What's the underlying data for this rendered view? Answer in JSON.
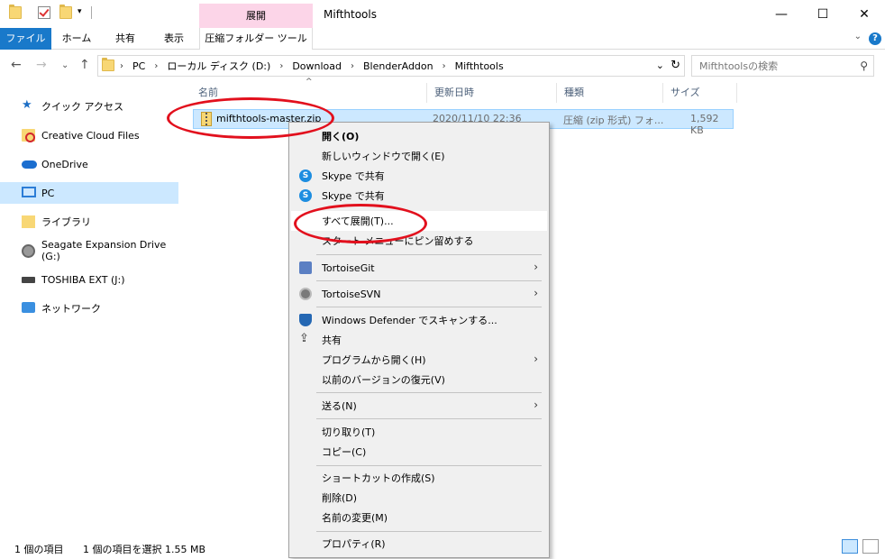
{
  "window": {
    "title": "Mifthtools",
    "contextual_tab_header": "展開",
    "controls": {
      "minimize": "—",
      "maximize": "☐",
      "close": "✕"
    }
  },
  "ribbon": {
    "tabs": [
      "ファイル",
      "ホーム",
      "共有",
      "表示",
      "圧縮フォルダー ツール"
    ],
    "help": "?"
  },
  "address": {
    "crumbs": [
      "PC",
      "ローカル ディスク (D:)",
      "Download",
      "BlenderAddon",
      "Mifthtools"
    ],
    "search_placeholder": "Mifthtoolsの検索"
  },
  "sidebar": {
    "items": [
      {
        "label": "クイック アクセス",
        "icon": "star-icon"
      },
      {
        "label": "Creative Cloud Files",
        "icon": "creative-cloud-icon"
      },
      {
        "label": "OneDrive",
        "icon": "cloud-icon"
      },
      {
        "label": "PC",
        "icon": "computer-icon",
        "selected": true
      },
      {
        "label": "ライブラリ",
        "icon": "library-icon"
      },
      {
        "label": "Seagate Expansion Drive (G:)",
        "icon": "drive-icon"
      },
      {
        "label": "TOSHIBA EXT (J:)",
        "icon": "usb-drive-icon"
      },
      {
        "label": "ネットワーク",
        "icon": "network-icon"
      }
    ]
  },
  "columns": [
    "名前",
    "更新日時",
    "種類",
    "サイズ"
  ],
  "files": [
    {
      "name": "mifthtools-master.zip",
      "modified": "2020/11/10 22:36",
      "type": "圧縮 (zip 形式) フォ...",
      "size": "1,592 KB"
    }
  ],
  "context_menu": {
    "items": [
      "開く(O)",
      "新しいウィンドウで開く(E)",
      "Skype で共有",
      "Skype で共有",
      "すべて展開(T)...",
      "スタート メニューにピン留めする",
      "TortoiseGit",
      "TortoiseSVN",
      "Windows Defender でスキャンする...",
      "共有",
      "プログラムから開く(H)",
      "以前のバージョンの復元(V)",
      "送る(N)",
      "切り取り(T)",
      "コピー(C)",
      "ショートカットの作成(S)",
      "削除(D)",
      "名前の変更(M)",
      "プロパティ(R)"
    ]
  },
  "status": {
    "count": "1 個の項目",
    "selection": "1 個の項目を選択  1.55 MB"
  },
  "colors": {
    "accent": "#1979ca",
    "selection": "#cce8ff",
    "annotation": "#e2101d",
    "context_tab": "#fcd5e8"
  }
}
